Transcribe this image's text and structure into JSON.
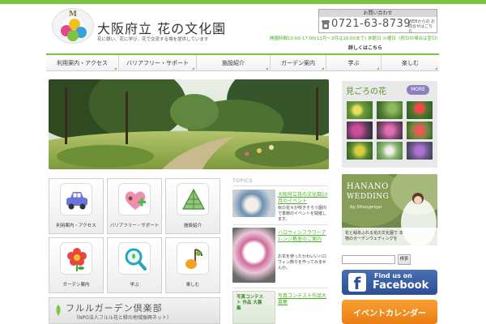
{
  "header": {
    "title": "大阪府立 花の文化園",
    "tagline": "花に憩い、花に学び、花で交流する場を提供しています",
    "contact_label": "お問い合わせ",
    "phone": "0721-63-8739",
    "web_contact": "WEBからの お問合せはこちら",
    "hours": "開園時間10:00-17:00(12月〜2月は16:00まで) 休館日 火曜日（祝日の場合は翌日）年末年始",
    "hours_link": "詳しくはこちら"
  },
  "nav": {
    "items": [
      {
        "label": "利用案内・アクセス"
      },
      {
        "label": "バリアフリー・サポート"
      },
      {
        "label": "施設紹介"
      },
      {
        "label": "ガーデン案内"
      },
      {
        "label": "学ぶ"
      },
      {
        "label": "楽しむ"
      }
    ]
  },
  "bloom": {
    "title": "見ごろの花",
    "more_label": "MORE"
  },
  "tiles": [
    {
      "label": "利用案内・アクセス",
      "icon": "car-icon"
    },
    {
      "label": "バリアフリー・サポート",
      "icon": "heart-plus-icon"
    },
    {
      "label": "施設紹介",
      "icon": "greenhouse-icon"
    },
    {
      "label": "ガーデン案内",
      "icon": "flower-icon"
    },
    {
      "label": "学ぶ",
      "icon": "magnifier-icon"
    },
    {
      "label": "楽しむ",
      "icon": "music-note-icon"
    }
  ],
  "club": {
    "name": "フルルガーデン倶楽部",
    "sub": "（NPO法人フルル花と緑の地域振興ネット）"
  },
  "topics": {
    "heading": "TOPICS",
    "items": [
      {
        "title": "大阪府立花の文化園10月のイベント",
        "body": "秋の花々が咲きそろう園内で季節のイベントを開催します。"
      },
      {
        "title": "ハロウィンフラワーアレンジ教室のご案内",
        "body": "お花を使ったかわいいハロウィン飾りを作ってみませんか。"
      },
      {
        "title": "写真コンテスト作品大募集",
        "body": ""
      }
    ],
    "contest_badge": "写真コンテスト 作品 大募集"
  },
  "wedding": {
    "line1": "HANANO",
    "line2": "WEDDING",
    "by": "by Shougenya",
    "caption": "花と緑あふれる花の文化園で 本物のガーデンウェディングを"
  },
  "search": {
    "placeholder": "",
    "button_label": "検索"
  },
  "facebook": {
    "find": "Find us on",
    "name": "Facebook"
  },
  "event": {
    "label": "イベントカレンダー"
  },
  "colors": {
    "accent_green": "#7cc243",
    "text_green": "#4caf2a",
    "more_purple": "#8e7fbf",
    "facebook_blue": "#3b5998",
    "event_orange": "#f39026"
  }
}
